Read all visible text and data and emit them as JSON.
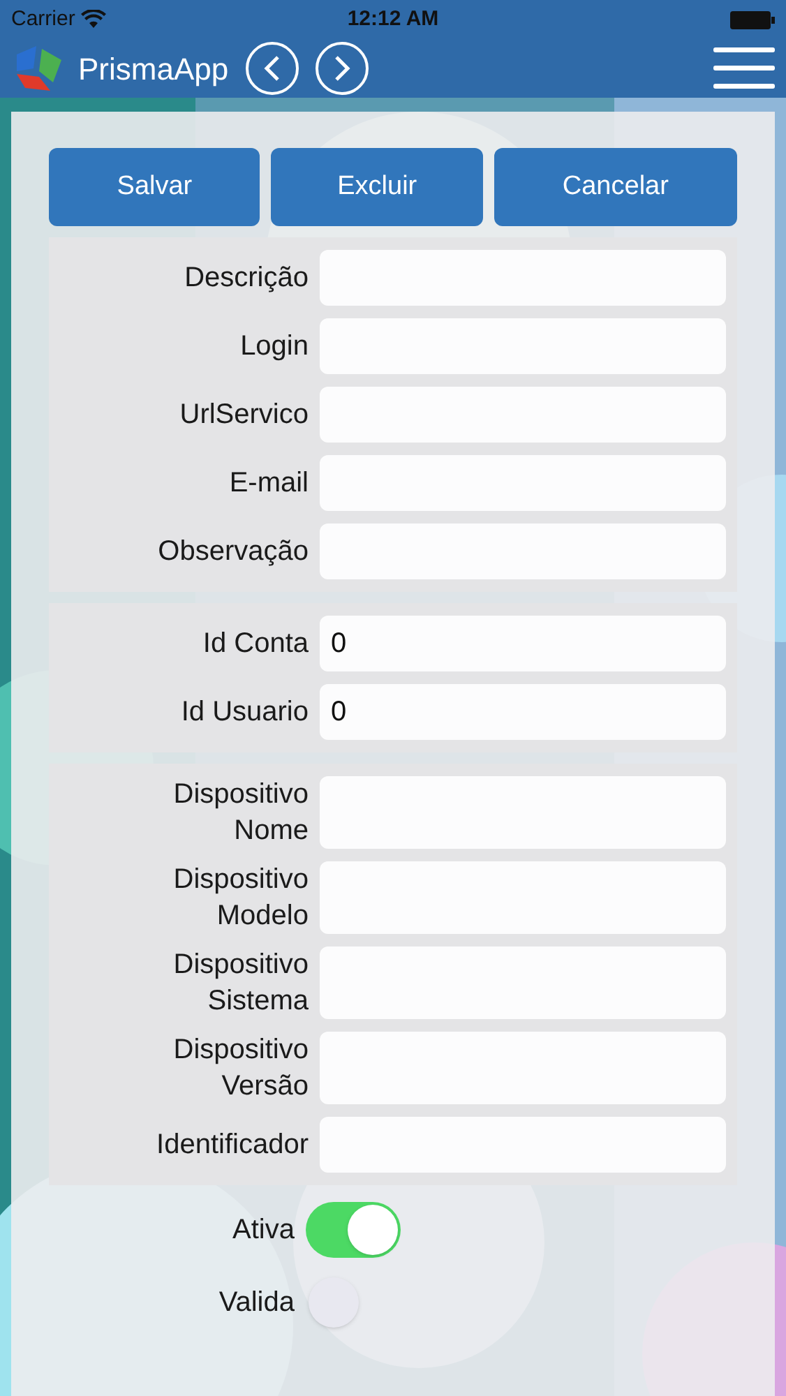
{
  "status_bar": {
    "carrier": "Carrier",
    "time": "12:12 AM"
  },
  "nav_bar": {
    "title": "PrismaApp"
  },
  "buttons": [
    "Salvar",
    "Excluir",
    "Cancelar"
  ],
  "sections": [
    {
      "fields": [
        {
          "label": "Descrição"
        },
        {
          "label": "Login"
        },
        {
          "label": "UrlServico"
        },
        {
          "label": "E-mail"
        },
        {
          "label": "Observação"
        }
      ]
    },
    {
      "fields": [
        {
          "label": "Id Conta",
          "value": "0"
        },
        {
          "label": "Id Usuario",
          "value": "0"
        }
      ]
    },
    {
      "fields": [
        {
          "label": "Dispositivo Nome"
        },
        {
          "label": "Dispositivo Modelo"
        },
        {
          "label": "Dispositivo Sistema"
        },
        {
          "label": "Dispositivo Versão"
        },
        {
          "label": "Identificador"
        }
      ]
    }
  ],
  "toggles": [
    {
      "label": "Ativa",
      "on": true
    },
    {
      "label": "Valida",
      "on": false
    }
  ]
}
